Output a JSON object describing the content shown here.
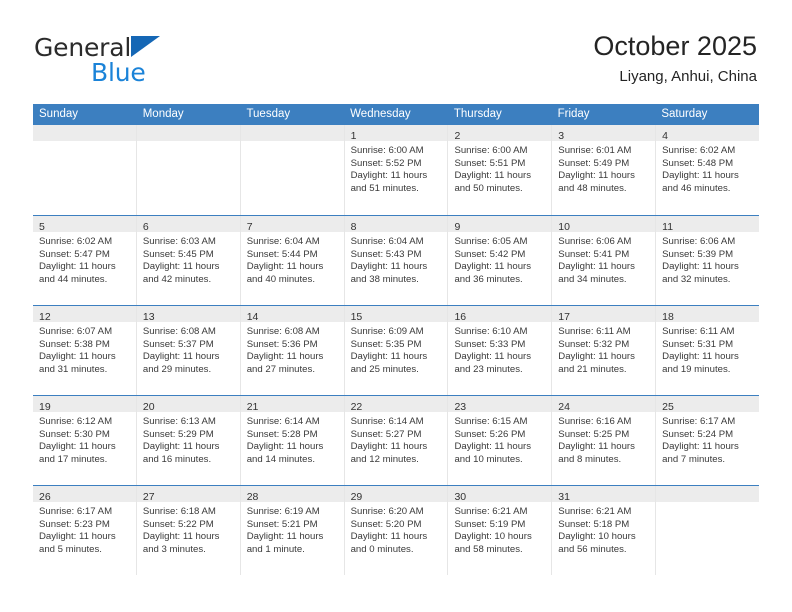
{
  "brand": {
    "word1": "General",
    "word2": "Blue",
    "triangle_color": "#1567b5",
    "blue_color": "#1b83d8"
  },
  "header": {
    "title": "October 2025",
    "subtitle": "Liyang, Anhui, China"
  },
  "theme": {
    "header_blue": "#3c7fc0",
    "day_band_gray": "#ececec",
    "cell_border": "#e6e6e6"
  },
  "day_headers": [
    "Sunday",
    "Monday",
    "Tuesday",
    "Wednesday",
    "Thursday",
    "Friday",
    "Saturday"
  ],
  "weeks": [
    [
      {
        "day": "",
        "lines": []
      },
      {
        "day": "",
        "lines": []
      },
      {
        "day": "",
        "lines": []
      },
      {
        "day": "1",
        "lines": [
          "Sunrise: 6:00 AM",
          "Sunset: 5:52 PM",
          "Daylight: 11 hours",
          "and 51 minutes."
        ]
      },
      {
        "day": "2",
        "lines": [
          "Sunrise: 6:00 AM",
          "Sunset: 5:51 PM",
          "Daylight: 11 hours",
          "and 50 minutes."
        ]
      },
      {
        "day": "3",
        "lines": [
          "Sunrise: 6:01 AM",
          "Sunset: 5:49 PM",
          "Daylight: 11 hours",
          "and 48 minutes."
        ]
      },
      {
        "day": "4",
        "lines": [
          "Sunrise: 6:02 AM",
          "Sunset: 5:48 PM",
          "Daylight: 11 hours",
          "and 46 minutes."
        ]
      }
    ],
    [
      {
        "day": "5",
        "lines": [
          "Sunrise: 6:02 AM",
          "Sunset: 5:47 PM",
          "Daylight: 11 hours",
          "and 44 minutes."
        ]
      },
      {
        "day": "6",
        "lines": [
          "Sunrise: 6:03 AM",
          "Sunset: 5:45 PM",
          "Daylight: 11 hours",
          "and 42 minutes."
        ]
      },
      {
        "day": "7",
        "lines": [
          "Sunrise: 6:04 AM",
          "Sunset: 5:44 PM",
          "Daylight: 11 hours",
          "and 40 minutes."
        ]
      },
      {
        "day": "8",
        "lines": [
          "Sunrise: 6:04 AM",
          "Sunset: 5:43 PM",
          "Daylight: 11 hours",
          "and 38 minutes."
        ]
      },
      {
        "day": "9",
        "lines": [
          "Sunrise: 6:05 AM",
          "Sunset: 5:42 PM",
          "Daylight: 11 hours",
          "and 36 minutes."
        ]
      },
      {
        "day": "10",
        "lines": [
          "Sunrise: 6:06 AM",
          "Sunset: 5:41 PM",
          "Daylight: 11 hours",
          "and 34 minutes."
        ]
      },
      {
        "day": "11",
        "lines": [
          "Sunrise: 6:06 AM",
          "Sunset: 5:39 PM",
          "Daylight: 11 hours",
          "and 32 minutes."
        ]
      }
    ],
    [
      {
        "day": "12",
        "lines": [
          "Sunrise: 6:07 AM",
          "Sunset: 5:38 PM",
          "Daylight: 11 hours",
          "and 31 minutes."
        ]
      },
      {
        "day": "13",
        "lines": [
          "Sunrise: 6:08 AM",
          "Sunset: 5:37 PM",
          "Daylight: 11 hours",
          "and 29 minutes."
        ]
      },
      {
        "day": "14",
        "lines": [
          "Sunrise: 6:08 AM",
          "Sunset: 5:36 PM",
          "Daylight: 11 hours",
          "and 27 minutes."
        ]
      },
      {
        "day": "15",
        "lines": [
          "Sunrise: 6:09 AM",
          "Sunset: 5:35 PM",
          "Daylight: 11 hours",
          "and 25 minutes."
        ]
      },
      {
        "day": "16",
        "lines": [
          "Sunrise: 6:10 AM",
          "Sunset: 5:33 PM",
          "Daylight: 11 hours",
          "and 23 minutes."
        ]
      },
      {
        "day": "17",
        "lines": [
          "Sunrise: 6:11 AM",
          "Sunset: 5:32 PM",
          "Daylight: 11 hours",
          "and 21 minutes."
        ]
      },
      {
        "day": "18",
        "lines": [
          "Sunrise: 6:11 AM",
          "Sunset: 5:31 PM",
          "Daylight: 11 hours",
          "and 19 minutes."
        ]
      }
    ],
    [
      {
        "day": "19",
        "lines": [
          "Sunrise: 6:12 AM",
          "Sunset: 5:30 PM",
          "Daylight: 11 hours",
          "and 17 minutes."
        ]
      },
      {
        "day": "20",
        "lines": [
          "Sunrise: 6:13 AM",
          "Sunset: 5:29 PM",
          "Daylight: 11 hours",
          "and 16 minutes."
        ]
      },
      {
        "day": "21",
        "lines": [
          "Sunrise: 6:14 AM",
          "Sunset: 5:28 PM",
          "Daylight: 11 hours",
          "and 14 minutes."
        ]
      },
      {
        "day": "22",
        "lines": [
          "Sunrise: 6:14 AM",
          "Sunset: 5:27 PM",
          "Daylight: 11 hours",
          "and 12 minutes."
        ]
      },
      {
        "day": "23",
        "lines": [
          "Sunrise: 6:15 AM",
          "Sunset: 5:26 PM",
          "Daylight: 11 hours",
          "and 10 minutes."
        ]
      },
      {
        "day": "24",
        "lines": [
          "Sunrise: 6:16 AM",
          "Sunset: 5:25 PM",
          "Daylight: 11 hours",
          "and 8 minutes."
        ]
      },
      {
        "day": "25",
        "lines": [
          "Sunrise: 6:17 AM",
          "Sunset: 5:24 PM",
          "Daylight: 11 hours",
          "and 7 minutes."
        ]
      }
    ],
    [
      {
        "day": "26",
        "lines": [
          "Sunrise: 6:17 AM",
          "Sunset: 5:23 PM",
          "Daylight: 11 hours",
          "and 5 minutes."
        ]
      },
      {
        "day": "27",
        "lines": [
          "Sunrise: 6:18 AM",
          "Sunset: 5:22 PM",
          "Daylight: 11 hours",
          "and 3 minutes."
        ]
      },
      {
        "day": "28",
        "lines": [
          "Sunrise: 6:19 AM",
          "Sunset: 5:21 PM",
          "Daylight: 11 hours",
          "and 1 minute."
        ]
      },
      {
        "day": "29",
        "lines": [
          "Sunrise: 6:20 AM",
          "Sunset: 5:20 PM",
          "Daylight: 11 hours",
          "and 0 minutes."
        ]
      },
      {
        "day": "30",
        "lines": [
          "Sunrise: 6:21 AM",
          "Sunset: 5:19 PM",
          "Daylight: 10 hours",
          "and 58 minutes."
        ]
      },
      {
        "day": "31",
        "lines": [
          "Sunrise: 6:21 AM",
          "Sunset: 5:18 PM",
          "Daylight: 10 hours",
          "and 56 minutes."
        ]
      },
      {
        "day": "",
        "lines": []
      }
    ]
  ]
}
